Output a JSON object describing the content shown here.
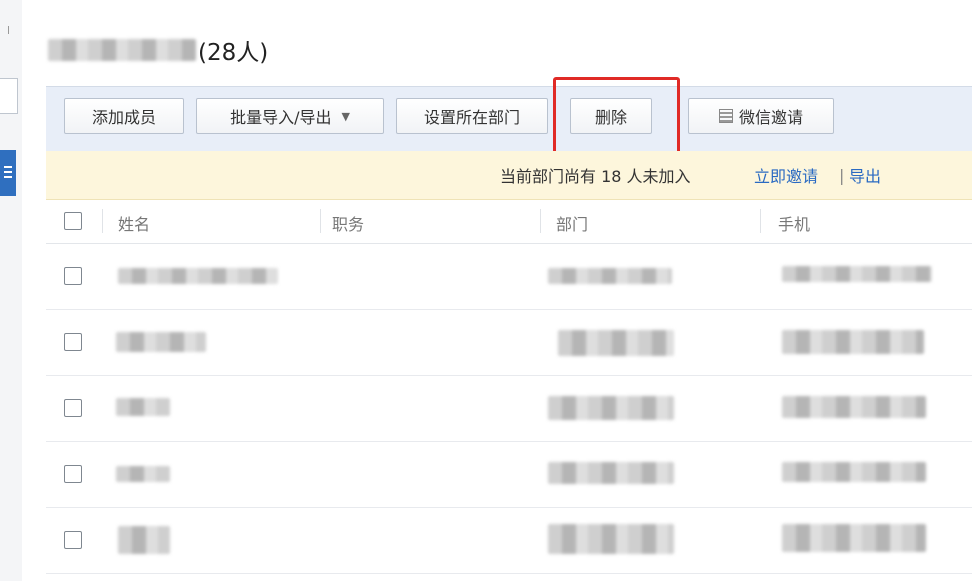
{
  "page": {
    "member_count": "(28人)"
  },
  "toolbar": {
    "add_member": "添加成员",
    "import_export": "批量导入/导出",
    "import_export_caret": "▼",
    "set_department": "设置所在部门",
    "delete": "删除",
    "wechat_invite": "微信邀请"
  },
  "notice": {
    "message": "当前部门尚有 18 人未加入",
    "invite_link": "立即邀请",
    "separator": "|",
    "export_link": "导出"
  },
  "table": {
    "headers": {
      "name": "姓名",
      "position": "职务",
      "department": "部门",
      "mobile": "手机"
    },
    "row_count_visible": 5
  },
  "colors": {
    "toolbar_bg": "#e8eef8",
    "notice_bg": "#fdf6dc",
    "link": "#2a6ac2",
    "highlight": "#e02a26",
    "sidebar_active": "#2f6fbf"
  }
}
